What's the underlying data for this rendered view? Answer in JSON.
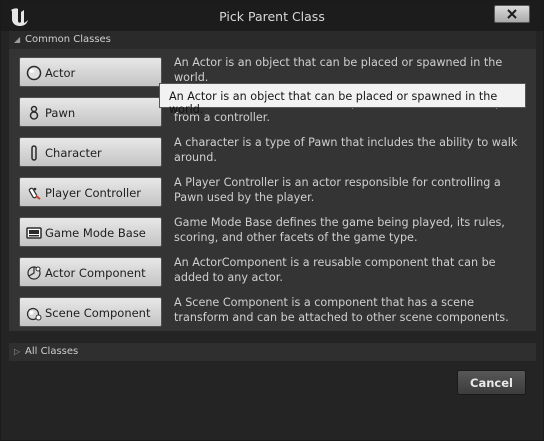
{
  "window": {
    "title": "Pick Parent Class"
  },
  "sections": {
    "common": {
      "label": "Common Classes",
      "expanded": true
    },
    "all": {
      "label": "All Classes",
      "expanded": false
    }
  },
  "classes": [
    {
      "name": "Actor",
      "icon": "actor-sphere-icon",
      "description": "An Actor is an object that can be placed or spawned in the world."
    },
    {
      "name": "Pawn",
      "icon": "pawn-icon",
      "description": "A Pawn is an actor that can be 'possessed' and receive input from a controller."
    },
    {
      "name": "Character",
      "icon": "character-icon",
      "description": "A character is a type of Pawn that includes the ability to walk around."
    },
    {
      "name": "Player Controller",
      "icon": "player-controller-icon",
      "description": "A Player Controller is an actor responsible for controlling a Pawn used by the player."
    },
    {
      "name": "Game Mode Base",
      "icon": "game-mode-icon",
      "description": "Game Mode Base defines the game being played, its rules, scoring, and other facets of the game type."
    },
    {
      "name": "Actor Component",
      "icon": "actor-component-icon",
      "description": "An ActorComponent is a reusable component that can be added to any actor."
    },
    {
      "name": "Scene Component",
      "icon": "scene-component-icon",
      "description": "A Scene Component is a component that has a scene transform and can be attached to other scene components."
    }
  ],
  "tooltip": {
    "text": "An Actor is an object that can be placed or spawned in the world."
  },
  "footer": {
    "cancel_label": "Cancel"
  }
}
